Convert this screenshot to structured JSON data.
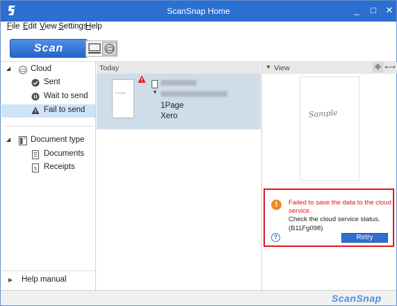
{
  "window": {
    "title": "ScanSnap Home",
    "min_glyph": "_",
    "max_glyph": "□",
    "close_glyph": "✕"
  },
  "menu": [
    {
      "label": "File",
      "hot": "F",
      "rest": "ile"
    },
    {
      "label": "Edit",
      "hot": "E",
      "rest": "dit"
    },
    {
      "label": "View",
      "hot": "V",
      "rest": "iew"
    },
    {
      "label": "Settings",
      "hot": "S",
      "rest": "ettings"
    },
    {
      "label": "Help",
      "hot": "H",
      "rest": "elp"
    }
  ],
  "toolbar": {
    "scan_label": "Scan"
  },
  "nav": {
    "cloud": {
      "label": "Cloud",
      "icon": "cloud-icon"
    },
    "sent": {
      "label": "Sent",
      "icon": "check-circle-icon"
    },
    "wait": {
      "label": "Wait to send",
      "icon": "pause-circle-icon"
    },
    "fail": {
      "label": "Fail to send",
      "icon": "warning-icon"
    },
    "doctype": {
      "label": "Document type",
      "icon": "document-type-icon"
    },
    "documents": {
      "label": "Documents",
      "icon": "document-icon"
    },
    "receipts": {
      "label": "Receipts",
      "icon": "receipt-icon"
    },
    "help": {
      "label": "Help manual"
    }
  },
  "list": {
    "group_header": "Today",
    "item": {
      "pages": "1Page",
      "service": "Xero",
      "thumb_text": "Sample"
    }
  },
  "view": {
    "header": "View",
    "preview_text": "Sample",
    "alert": {
      "message": "Failed to save the data to the cloud service.",
      "check": "Check the cloud service status.",
      "code": "(B11Fg098)",
      "retry_label": "Retry"
    }
  },
  "status": {
    "brand": "ScanSnap"
  },
  "colors": {
    "titlebar": "#2b6fd0",
    "selected": "#cfe3f7",
    "alert_red": "#e1141b",
    "warn_orange": "#ef8a1e",
    "primary_blue": "#2f6fd0"
  }
}
